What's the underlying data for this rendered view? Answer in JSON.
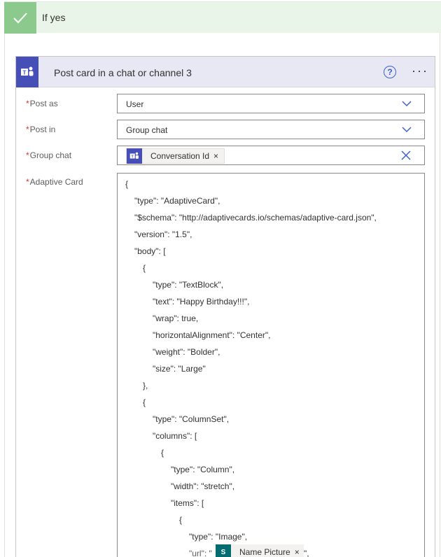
{
  "branch": {
    "title": "If yes"
  },
  "action": {
    "title": "Post card in a chat or channel 3"
  },
  "fields": {
    "post_as": {
      "label": "Post as",
      "value": "User"
    },
    "post_in": {
      "label": "Post in",
      "value": "Group chat"
    },
    "group_chat": {
      "label": "Group chat",
      "token": "Conversation Id"
    },
    "adaptive_card": {
      "label": "Adaptive Card"
    }
  },
  "json_lines": [
    "{",
    "\"type\": \"AdaptiveCard\",",
    "\"$schema\": \"http://adaptivecards.io/schemas/adaptive-card.json\",",
    "\"version\": \"1.5\",",
    "\"body\": [",
    "{",
    "\"type\": \"TextBlock\",",
    "\"text\": \"Happy Birthday!!!\",",
    "\"wrap\": true,",
    "\"horizontalAlignment\": \"Center\",",
    "\"weight\": \"Bolder\",",
    "\"size\": \"Large\"",
    "},",
    "{",
    "\"type\": \"ColumnSet\",",
    "\"columns\": [",
    "{",
    "\"type\": \"Column\",",
    "\"width\": \"stretch\",",
    "\"items\": [",
    "{",
    "\"type\": \"Image\",",
    "\"url\": \""
  ],
  "inline_token": {
    "label": "Name Picture",
    "suffix": "\","
  },
  "colors": {
    "branch_bg": "#e9f5e9",
    "branch_check": "#8cc98c",
    "teams": "#464eb8",
    "header_bg": "#e8e8f5",
    "required": "#d13438",
    "sharepoint": "#036c70"
  }
}
